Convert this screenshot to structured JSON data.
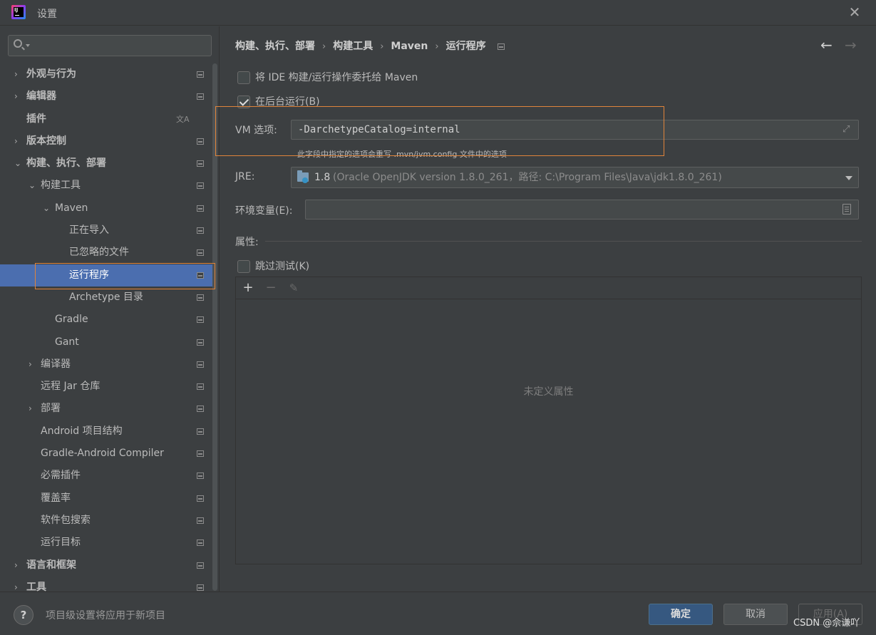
{
  "window": {
    "title": "设置"
  },
  "search": {
    "placeholder": ""
  },
  "sidebar": {
    "items": [
      {
        "label": "外观与行为",
        "bold": true,
        "chevron": "›",
        "level": 0
      },
      {
        "label": "编辑器",
        "bold": true,
        "chevron": "›",
        "level": 0
      },
      {
        "label": "插件",
        "bold": true,
        "chevron": "",
        "level": 0,
        "icon": "translate-icon"
      },
      {
        "label": "版本控制",
        "bold": true,
        "chevron": "›",
        "level": 0
      },
      {
        "label": "构建、执行、部署",
        "bold": true,
        "chevron": "⌄",
        "level": 0
      },
      {
        "label": "构建工具",
        "bold": false,
        "chevron": "⌄",
        "level": 1
      },
      {
        "label": "Maven",
        "bold": false,
        "chevron": "⌄",
        "level": 2
      },
      {
        "label": "正在导入",
        "bold": false,
        "chevron": "",
        "level": 3
      },
      {
        "label": "已忽略的文件",
        "bold": false,
        "chevron": "",
        "level": 3
      },
      {
        "label": "运行程序",
        "bold": false,
        "chevron": "",
        "level": 3,
        "selected": true
      },
      {
        "label": "Archetype 目录",
        "bold": false,
        "chevron": "",
        "level": 3
      },
      {
        "label": "Gradle",
        "bold": false,
        "chevron": "",
        "level": 2
      },
      {
        "label": "Gant",
        "bold": false,
        "chevron": "",
        "level": 2
      },
      {
        "label": "编译器",
        "bold": false,
        "chevron": "›",
        "level": 1
      },
      {
        "label": "远程 Jar 仓库",
        "bold": false,
        "chevron": "",
        "level": 1
      },
      {
        "label": "部署",
        "bold": false,
        "chevron": "›",
        "level": 1
      },
      {
        "label": "Android 项目结构",
        "bold": false,
        "chevron": "",
        "level": 1
      },
      {
        "label": "Gradle-Android Compiler",
        "bold": false,
        "chevron": "",
        "level": 1
      },
      {
        "label": "必需插件",
        "bold": false,
        "chevron": "",
        "level": 1
      },
      {
        "label": "覆盖率",
        "bold": false,
        "chevron": "",
        "level": 1
      },
      {
        "label": "软件包搜索",
        "bold": false,
        "chevron": "",
        "level": 1
      },
      {
        "label": "运行目标",
        "bold": false,
        "chevron": "",
        "level": 1
      },
      {
        "label": "语言和框架",
        "bold": true,
        "chevron": "›",
        "level": 0
      },
      {
        "label": "工具",
        "bold": true,
        "chevron": "›",
        "level": 0
      }
    ]
  },
  "breadcrumb": {
    "items": [
      "构建、执行、部署",
      "构建工具",
      "Maven",
      "运行程序"
    ],
    "separator": "›"
  },
  "nav": {
    "back": "←",
    "forward": "→"
  },
  "settings": {
    "delegate_label": "将 IDE 构建/运行操作委托给 Maven",
    "delegate_checked": false,
    "background_label": "在后台运行(B)",
    "background_checked": true,
    "vm_label": "VM 选项:",
    "vm_value": "-DarchetypeCatalog=internal",
    "vm_hint": "此字段中指定的选项会重写 .mvn/jvm.config 文件中的选项",
    "jre_label": "JRE:",
    "jre_version": "1.8",
    "jre_description": "(Oracle OpenJDK version 1.8.0_261，路径: C:\\Program Files\\Java\\jdk1.8.0_261)",
    "env_label": "环境变量(E):",
    "env_value": "",
    "properties_label": "属性:",
    "skip_tests_label": "跳过测试(K)",
    "skip_tests_checked": false,
    "properties_empty": "未定义属性",
    "toolbar": {
      "add": "+",
      "remove": "−",
      "edit": "✎"
    }
  },
  "footer": {
    "help": "?",
    "note": "项目级设置将应用于新项目",
    "ok": "确定",
    "cancel": "取消",
    "apply": "应用(A)"
  },
  "watermark": "CSDN @佘谦吖",
  "colors": {
    "background": "#3c3f41",
    "selection": "#4b6eaf",
    "highlight_box": "#e0843b",
    "primary_button": "#365880"
  }
}
